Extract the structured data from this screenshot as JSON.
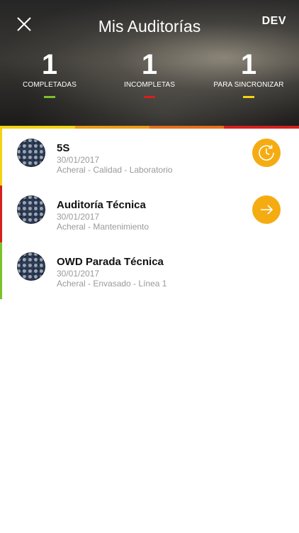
{
  "header": {
    "title": "Mis Auditorías",
    "env_label": "DEV"
  },
  "stats": [
    {
      "value": "1",
      "label": "COMPLETADAS",
      "color": "#7cc12a"
    },
    {
      "value": "1",
      "label": "INCOMPLETAS",
      "color": "#d52020"
    },
    {
      "value": "1",
      "label": "PARA SINCRONIZAR",
      "color": "#f3d311"
    }
  ],
  "status_strip": [
    "#f3d311",
    "#ef9b18",
    "#e8701c",
    "#d52020"
  ],
  "audits": [
    {
      "title": "5S",
      "date": "30/01/2017",
      "location": "Acheral - Calidad - Laboratorio",
      "status_color": "#f3d311",
      "action_icon": "sync-clock-icon"
    },
    {
      "title": "Auditoría Técnica",
      "date": "30/01/2017",
      "location": "Acheral - Mantenimiento",
      "status_color": "#d52020",
      "action_icon": "arrow-right-icon"
    },
    {
      "title": "OWD Parada Técnica",
      "date": "30/01/2017",
      "location": "Acheral - Envasado - Línea 1",
      "status_color": "#7cc12a",
      "action_icon": ""
    }
  ],
  "colors": {
    "accent": "#f5ac12"
  }
}
